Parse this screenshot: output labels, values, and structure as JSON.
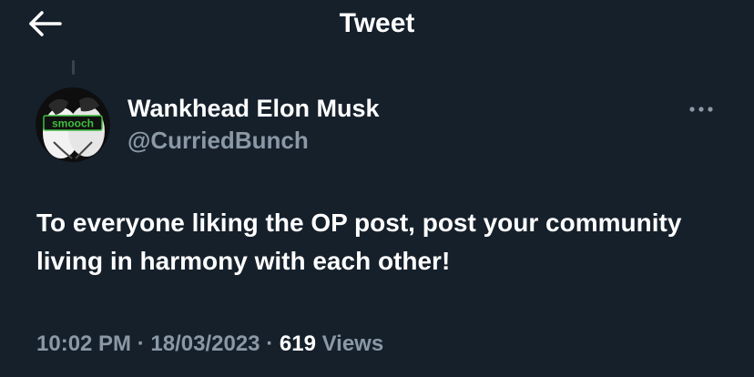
{
  "header": {
    "title": "Tweet",
    "back_icon": "arrow-left-icon"
  },
  "tweet": {
    "author": {
      "display_name": "Wankhead Elon Musk",
      "handle": "@CurriedBunch",
      "avatar_label": "smooch",
      "avatar_label_color": "#3fbf3f"
    },
    "more_icon": "more-horizontal-icon",
    "text": "To everyone liking the OP post, post your community living in harmony with each other!",
    "time": "10:02 PM",
    "separator": "·",
    "date": "18/03/2023",
    "views_count": "619",
    "views_label": "Views"
  },
  "colors": {
    "background": "#15202b",
    "primary_text": "#ffffff",
    "secondary_text": "#8b98a5"
  }
}
